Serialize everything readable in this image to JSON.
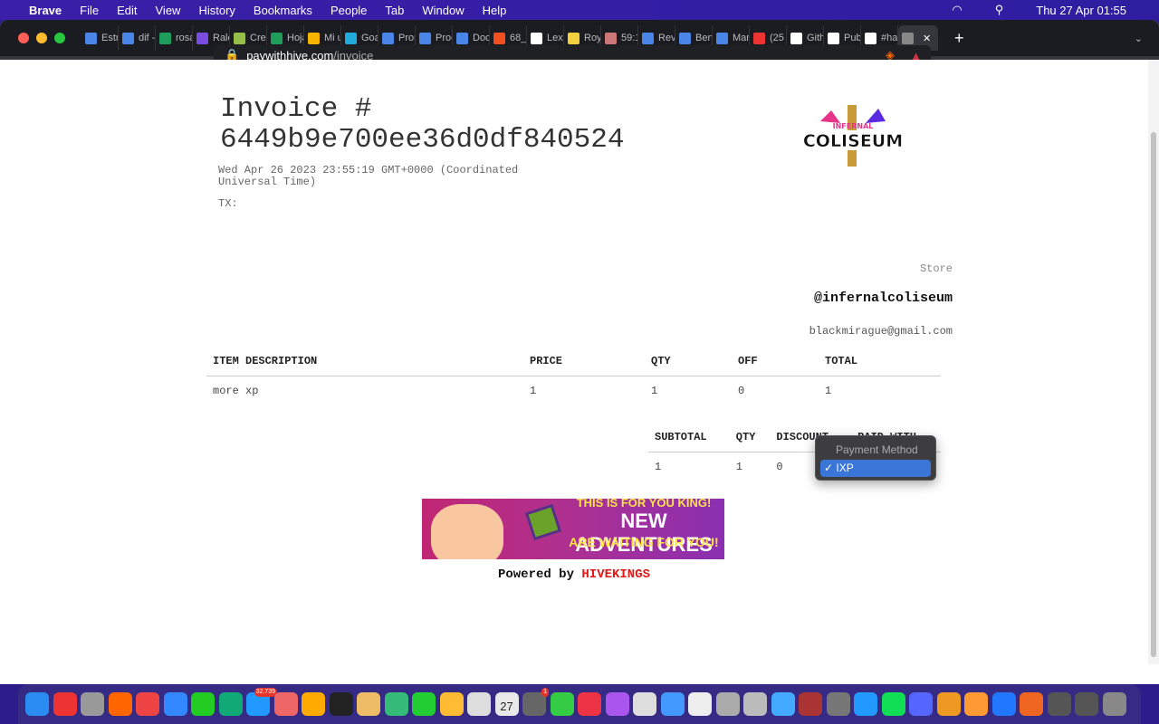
{
  "menubar": {
    "app": "Brave",
    "items": [
      "File",
      "Edit",
      "View",
      "History",
      "Bookmarks",
      "People",
      "Tab",
      "Window",
      "Help"
    ],
    "clock": "Thu 27 Apr  01:55"
  },
  "tabs": [
    "Estr",
    "dif -",
    "rosa",
    "Rale",
    "Crea",
    "Hoja",
    "Mi u",
    "Goa",
    "Pror",
    "Proc",
    "Doc",
    "68_",
    "Lexi",
    "Roy",
    "59:1",
    "Rev",
    "Ben",
    "Mar",
    "(25",
    "Gith",
    "Pub",
    "#ha",
    ""
  ],
  "tab_colors": [
    "#4a86e8",
    "#4a86e8",
    "#1e9e5a",
    "#7a4ce0",
    "#95bf47",
    "#1e9e5a",
    "#f4b400",
    "#2ad",
    "#4a86e8",
    "#4a86e8",
    "#4a86e8",
    "#f24e1e",
    "#fff",
    "#f4d03f",
    "#c77",
    "#4a86e8",
    "#4a86e8",
    "#4a86e8",
    "#e33",
    "#fff",
    "#fff",
    "#fff",
    "#888"
  ],
  "address": {
    "domain": "paywithhive.com",
    "path": "/invoice"
  },
  "invoice": {
    "title": "Invoice #",
    "id": "6449b9e700ee36d0df840524",
    "date": "Wed Apr 26 2023 23:55:19 GMT+0000 (Coordinated Universal Time)",
    "tx": "TX:"
  },
  "logo": {
    "top": "INFERNAL",
    "main": "COLISEUM"
  },
  "store": {
    "label": "Store",
    "handle": "@infernalcoliseum",
    "email": "blackmirague@gmail.com"
  },
  "items_table": {
    "headers": [
      "ITEM DESCRIPTION",
      "PRICE",
      "QTY",
      "OFF",
      "TOTAL"
    ],
    "rows": [
      [
        "more xp",
        "1",
        "1",
        "0",
        "1"
      ]
    ]
  },
  "summary_table": {
    "headers": [
      "SUBTOTAL",
      "QTY",
      "DISCOUNT",
      "PAID WITH"
    ],
    "rows": [
      [
        "1",
        "1",
        "0",
        ""
      ]
    ]
  },
  "payment_popup": {
    "header": "Payment Method",
    "selected": "IXP",
    "check": "✓"
  },
  "banner": {
    "line1": "THIS IS FOR YOU KING!",
    "line2": "NEW ADVENTURES",
    "line3": "ARE WAITING FOR YOU!"
  },
  "footer": {
    "powered": "Powered by",
    "brand": "HIVEKINGS"
  },
  "dock": {
    "calendar_day": "27",
    "mail_badge": "32,739",
    "settings_badge": "1"
  }
}
